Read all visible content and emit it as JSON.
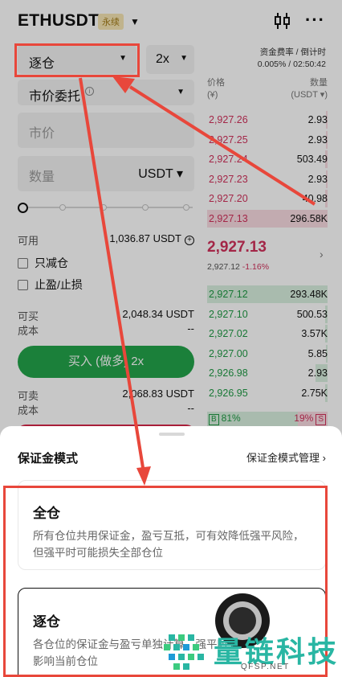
{
  "header": {
    "pair": "ETHUSDT",
    "badge": "永续"
  },
  "form": {
    "margin_mode": "逐仓",
    "leverage": "2x",
    "order_type": "市价委托",
    "price_placeholder": "市价",
    "qty_placeholder": "数量",
    "qty_unit": "USDT",
    "slider_percent": 0,
    "available_label": "可用",
    "available_value": "1,036.87 USDT",
    "reduce_only": "只减仓",
    "tp_sl": "止盈/止损",
    "can_buy_label": "可买",
    "can_buy_value": "2,048.34 USDT",
    "cost_label": "成本",
    "cost_value": "--",
    "buy_button": "买入 (做多) 2x",
    "can_sell_label": "可卖",
    "can_sell_value": "2,068.83 USDT",
    "cost2_label": "成本",
    "cost2_value": "--"
  },
  "orderbook": {
    "funding_label": "资金费率 / 倒计时",
    "funding_value": "0.005% / 02:50:42",
    "price_header": "价格",
    "price_unit": "(¥)",
    "qty_header": "数量",
    "qty_unit": "(USDT ▾)",
    "asks": [
      {
        "price": "2,927.26",
        "qty": "2.93",
        "depth": 0.01
      },
      {
        "price": "2,927.25",
        "qty": "2.93",
        "depth": 0.01
      },
      {
        "price": "2,927.24",
        "qty": "503.49",
        "depth": 0.02
      },
      {
        "price": "2,927.23",
        "qty": "2.93",
        "depth": 0.01
      },
      {
        "price": "2,927.20",
        "qty": "40.98",
        "depth": 0.02
      },
      {
        "price": "2,927.13",
        "qty": "296.58K",
        "depth": 1.0
      }
    ],
    "last_price": "2,927.13",
    "mark_price": "2,927.12",
    "change": "-1.16%",
    "bids": [
      {
        "price": "2,927.12",
        "qty": "293.48K",
        "depth": 1.0
      },
      {
        "price": "2,927.10",
        "qty": "500.53",
        "depth": 0.02
      },
      {
        "price": "2,927.02",
        "qty": "3.57K",
        "depth": 0.02
      },
      {
        "price": "2,927.00",
        "qty": "5.85",
        "depth": 0.01
      },
      {
        "price": "2,926.98",
        "qty": "2.93",
        "depth": 0.1
      },
      {
        "price": "2,926.95",
        "qty": "2.75K",
        "depth": 0.02
      }
    ],
    "buy_tag": "B",
    "buy_ratio": "81%",
    "sell_ratio": "19%",
    "sell_tag": "S"
  },
  "sheet": {
    "title": "保证金模式",
    "manage_link": "保证金模式管理",
    "options": [
      {
        "title": "全仓",
        "desc": "所有仓位共用保证金，盈亏互抵，可有效降低强平风险，但强平时可能损失全部仓位"
      },
      {
        "title": "逐仓",
        "desc": "各仓位的保证金与盈亏单独计算，强平时只影响当前仓位"
      }
    ]
  },
  "watermark": {
    "brand": "量链科技",
    "site": "QFSP.NET"
  },
  "colors": {
    "buy": "#23a44b",
    "sell": "#d1315c",
    "annotation": "#e8473b",
    "brand": "#29b6a3"
  }
}
